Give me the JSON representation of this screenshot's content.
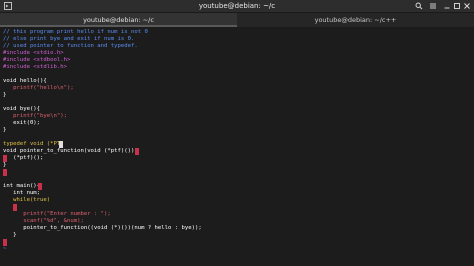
{
  "window": {
    "title": "youtube@debian: ~/c"
  },
  "tabs": [
    {
      "label": "youtube@debian: ~/c",
      "active": true
    },
    {
      "label": "youtube@debian: ~/c++",
      "active": false
    }
  ],
  "icons": {
    "new_tab": "terminal-icon",
    "search": "search-icon",
    "menu": "hamburger-menu-icon",
    "minimize": "minimize-icon",
    "maximize": "maximize-icon",
    "close": "close-icon"
  },
  "code": [
    "// this program print hello if num is not 0",
    "// else print bye and exit if num is 0.",
    "// used pointer to function and typedef.",
    "#include <stdio.h>",
    "#include <stdbool.h>",
    "#include <stdlib.h>",
    "",
    "void hello(){",
    "   printf(\"hello\\n\");",
    "}",
    "",
    "void bye(){",
    "   printf(\"bye\\n\");",
    "   exit(0);",
    "}",
    "",
    "typedef void (*PT",
    "void pointer_to_function(void (*ptf)()){",
    "   (*ptf)();",
    "}",
    "",
    "",
    "int main(){",
    "   int num;",
    "   while(true)",
    "   {",
    "      printf(\"Enter number : \");",
    "      scanf(\"%d\", &num);",
    "      pointer_to_function((void (*)())(num ? hello : bye));",
    "   }",
    "}",
    "~"
  ],
  "colors": {
    "background": "#1c1c1c",
    "comment": "#5c8ef0",
    "preprocessor": "#d35fd8",
    "string": "#e06070",
    "keyword": "#e0c040",
    "error_highlight": "#c9304a"
  }
}
